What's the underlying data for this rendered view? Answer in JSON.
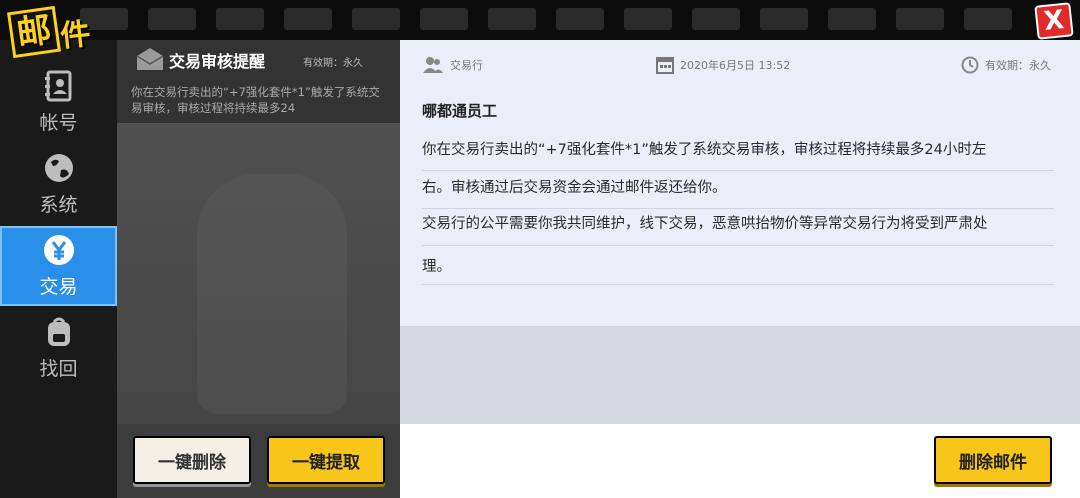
{
  "header": {
    "title_char_1": "邮",
    "title_char_2": "件",
    "close_label": "X"
  },
  "sidebar": {
    "items": [
      {
        "label": "帐号",
        "icon": "contacts-book-icon",
        "active": false
      },
      {
        "label": "系统",
        "icon": "globe-icon",
        "active": false
      },
      {
        "label": "交易",
        "icon": "yuan-coin-icon",
        "active": true
      },
      {
        "label": "找回",
        "icon": "backpack-icon",
        "active": false
      }
    ]
  },
  "mail_list": {
    "items": [
      {
        "title": "交易审核提醒",
        "validity": "有效期：永久",
        "preview": "你在交易行卖出的“+7强化套件*1”触发了系统交易审核，审核过程将持续最多24"
      }
    ],
    "delete_all_label": "一键删除",
    "collect_all_label": "一键提取"
  },
  "mail_detail": {
    "sender": "交易行",
    "date": "2020年6月5日  13:52",
    "validity": "有效期：永久",
    "greeting": "哪都通员工",
    "para1_line1": "你在交易行卖出的“+7强化套件*1”触发了系统交易审核，审核过程将持续最多24小时左",
    "para1_line2": "右。审核通过后交易资金会通过邮件返还给你。",
    "para2_line1": "交易行的公平需要你我共同维护，线下交易，恶意哄抬物价等异常交易行为将受到严肃处",
    "para2_line2": "理。",
    "delete_label": "删除邮件"
  },
  "colors": {
    "accent_blue": "#2a8fe8",
    "button_yellow": "#f8c51a",
    "close_red": "#e12a2a"
  }
}
